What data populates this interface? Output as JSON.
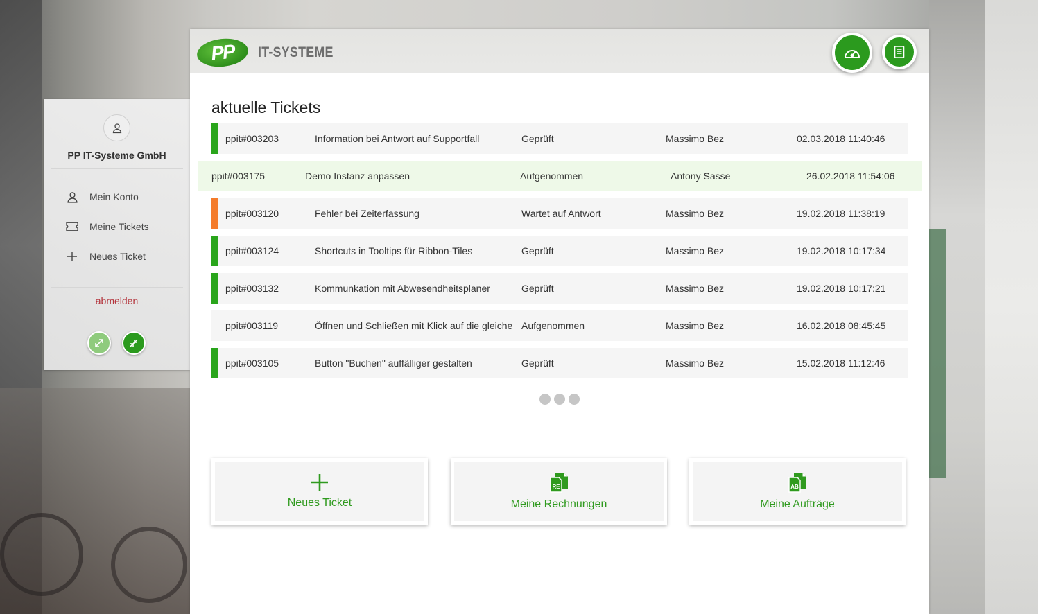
{
  "header": {
    "logo_mark": "PP",
    "logo_text": "IT-SYSTEME",
    "dashboard_icon": "speedometer-icon",
    "book_icon": "book-icon"
  },
  "sidebar": {
    "company": "PP IT-Systeme GmbH",
    "items": [
      {
        "label": "Mein Konto",
        "icon": "user-icon"
      },
      {
        "label": "Meine Tickets",
        "icon": "ticket-icon"
      },
      {
        "label": "Neues Ticket",
        "icon": "plus-icon"
      }
    ],
    "logout": "abmelden"
  },
  "main": {
    "title": "aktuelle Tickets",
    "tickets": [
      {
        "id": "ppit#003203",
        "title": "Information bei Antwort auf Supportfall",
        "status": "Geprüft",
        "user": "Massimo Bez",
        "date": "02.03.2018 11:40:46",
        "color": "#29a51b"
      },
      {
        "id": "ppit#003175",
        "title": "Demo Instanz anpassen",
        "status": "Aufgenommen",
        "user": "Antony Sasse",
        "date": "26.02.2018 11:54:06",
        "color": ""
      },
      {
        "id": "ppit#003120",
        "title": "Fehler bei Zeiterfassung",
        "status": "Wartet auf Antwort",
        "user": "Massimo Bez",
        "date": "19.02.2018 11:38:19",
        "color": "#f47b2a"
      },
      {
        "id": "ppit#003124",
        "title": "Shortcuts in Tooltips für Ribbon-Tiles",
        "status": "Geprüft",
        "user": "Massimo Bez",
        "date": "19.02.2018 10:17:34",
        "color": "#29a51b"
      },
      {
        "id": "ppit#003132",
        "title": "Kommunkation mit Abwesendheitsplaner",
        "status": "Geprüft",
        "user": "Massimo Bez",
        "date": "19.02.2018 10:17:21",
        "color": "#29a51b"
      },
      {
        "id": "ppit#003119",
        "title": "Öffnen und Schließen mit Klick auf die gleiche",
        "status": "Aufgenommen",
        "user": "Massimo Bez",
        "date": "16.02.2018 08:45:45",
        "color": "#f5f5f5"
      },
      {
        "id": "ppit#003105",
        "title": "Button \"Buchen\" auffälliger gestalten",
        "status": "Geprüft",
        "user": "Massimo Bez",
        "date": "15.02.2018 11:12:46",
        "color": "#29a51b"
      }
    ],
    "tiles": [
      {
        "label": "Neues Ticket",
        "icon": "plus-icon"
      },
      {
        "label": "Meine Rechnungen",
        "icon": "invoice-document-icon",
        "badge": "RE"
      },
      {
        "label": "Meine Aufträge",
        "icon": "order-document-icon",
        "badge": "AB"
      }
    ]
  },
  "colors": {
    "accent": "#2b9a1e",
    "orange": "#f47b2a",
    "logout": "#b3323a"
  }
}
